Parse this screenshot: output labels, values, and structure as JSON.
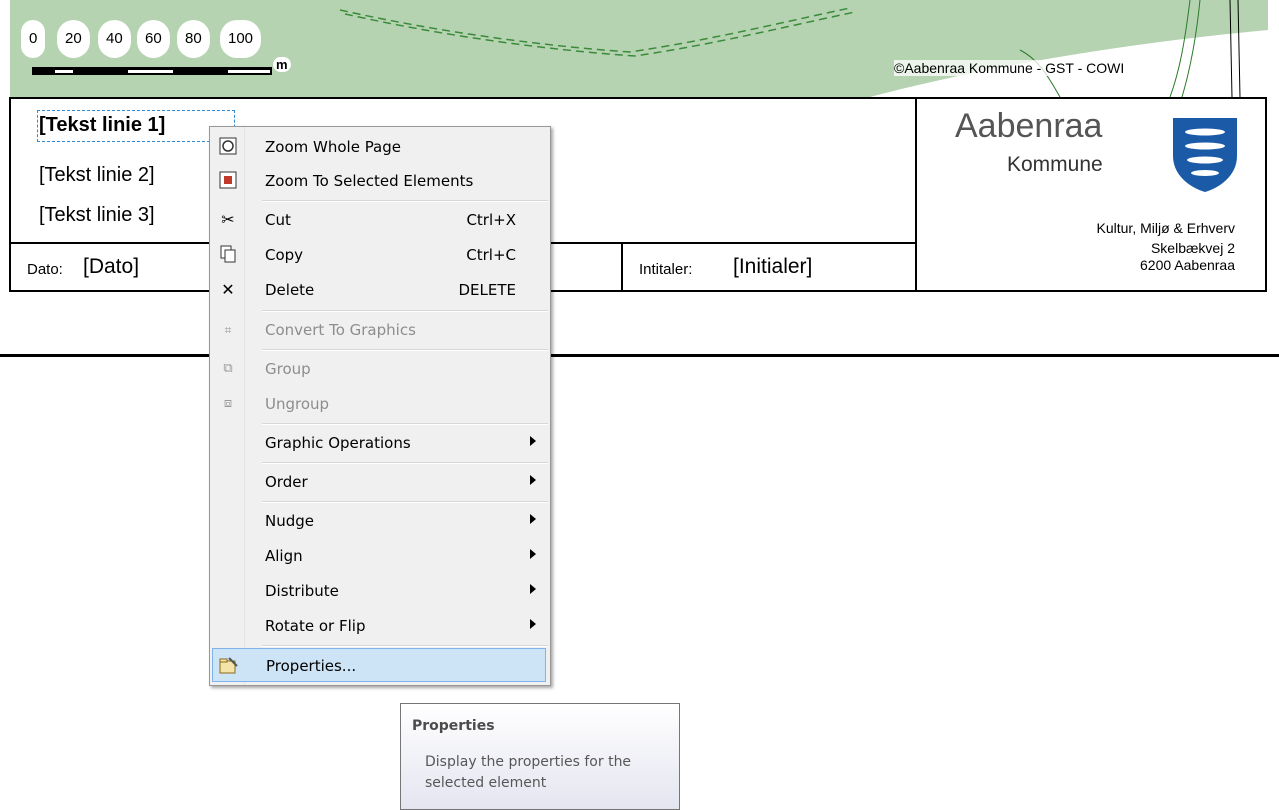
{
  "map": {
    "scale_ticks": [
      "0",
      "20",
      "40",
      "60",
      "80",
      "100"
    ],
    "scale_unit": "m",
    "copyright": "©Aabenraa Kommune - GST - COWI",
    "land_color": "#b5d3b1"
  },
  "title_block": {
    "text_lines": [
      "[Tekst linie 1]",
      "[Tekst linie 2]",
      "[Tekst linie 3]"
    ],
    "date_label": "Dato:",
    "date_value": "[Dato]",
    "initials_label": "Intitaler:",
    "initials_value": "[Initialer]",
    "logo_name": "Aabenraa",
    "logo_sub": "Kommune",
    "address": [
      "Kultur, Miljø & Erhverv",
      "Skelbækvej 2",
      "6200 Aabenraa"
    ]
  },
  "context_menu": {
    "items": [
      {
        "label": "Zoom Whole Page",
        "shortcut": "",
        "icon": "zoom-whole-page-icon",
        "disabled": false,
        "submenu": false
      },
      {
        "label": "Zoom To Selected Elements",
        "shortcut": "",
        "icon": "zoom-selected-icon",
        "disabled": false,
        "submenu": false
      },
      {
        "label": "Cut",
        "shortcut": "Ctrl+X",
        "icon": "scissors-icon",
        "disabled": false,
        "submenu": false
      },
      {
        "label": "Copy",
        "shortcut": "Ctrl+C",
        "icon": "copy-icon",
        "disabled": false,
        "submenu": false
      },
      {
        "label": "Delete",
        "shortcut": "DELETE",
        "icon": "delete-x-icon",
        "disabled": false,
        "submenu": false
      },
      {
        "label": "Convert To Graphics",
        "shortcut": "",
        "icon": "convert-graphics-icon",
        "disabled": true,
        "submenu": false
      },
      {
        "label": "Group",
        "shortcut": "",
        "icon": "group-icon",
        "disabled": true,
        "submenu": false
      },
      {
        "label": "Ungroup",
        "shortcut": "",
        "icon": "ungroup-icon",
        "disabled": true,
        "submenu": false
      },
      {
        "label": "Graphic Operations",
        "shortcut": "",
        "icon": "",
        "disabled": false,
        "submenu": true
      },
      {
        "label": "Order",
        "shortcut": "",
        "icon": "",
        "disabled": false,
        "submenu": true
      },
      {
        "label": "Nudge",
        "shortcut": "",
        "icon": "",
        "disabled": false,
        "submenu": true
      },
      {
        "label": "Align",
        "shortcut": "",
        "icon": "",
        "disabled": false,
        "submenu": true
      },
      {
        "label": "Distribute",
        "shortcut": "",
        "icon": "",
        "disabled": false,
        "submenu": true
      },
      {
        "label": "Rotate or Flip",
        "shortcut": "",
        "icon": "",
        "disabled": false,
        "submenu": true
      },
      {
        "label": "Properties...",
        "shortcut": "",
        "icon": "properties-icon",
        "disabled": false,
        "submenu": false
      }
    ],
    "highlighted": "Properties..."
  },
  "tooltip": {
    "title": "Properties",
    "body": "Display the properties for the selected element"
  }
}
